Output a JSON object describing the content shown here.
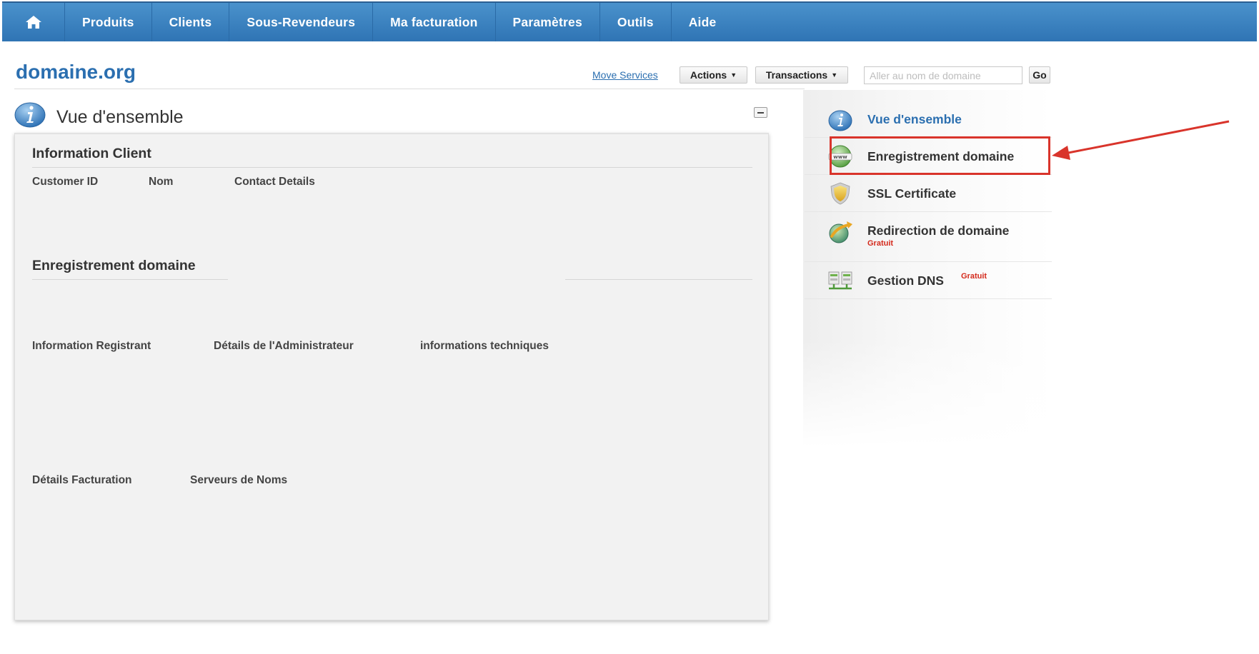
{
  "nav": {
    "home_icon": "home-icon",
    "items": [
      "Produits",
      "Clients",
      "Sous-Revendeurs",
      "Ma facturation",
      "Paramètres",
      "Outils",
      "Aide"
    ]
  },
  "header": {
    "domain": "domaine.org",
    "move_services": "Move Services",
    "actions": "Actions",
    "transactions": "Transactions",
    "search_placeholder": "Aller au nom de domaine",
    "go": "Go"
  },
  "overview": {
    "title": "Vue d'ensemble",
    "icon": "info-icon",
    "client_section": {
      "title": "Information Client",
      "fields": [
        "Customer ID",
        "Nom",
        "Contact Details"
      ]
    },
    "domain_section": {
      "title": "Enregistrement domaine",
      "fields_row1": [
        "Information Registrant",
        "Détails de l'Administrateur",
        "informations techniques"
      ],
      "fields_row2": [
        "Détails Facturation",
        "Serveurs de Noms"
      ]
    }
  },
  "sidebar": {
    "items": [
      {
        "label": "Vue d'ensemble",
        "icon": "info-icon",
        "active": true
      },
      {
        "label": "Enregistrement domaine",
        "icon": "www-globe-icon",
        "highlighted": true
      },
      {
        "label": "SSL Certificate",
        "icon": "shield-icon"
      },
      {
        "label": "Redirection de domaine",
        "icon": "redirect-globe-icon",
        "badge": "Gratuit"
      },
      {
        "label": "Gestion DNS",
        "icon": "dns-servers-icon",
        "badge": "Gratuit"
      }
    ]
  },
  "colors": {
    "nav_bg": "#3a84c2",
    "link_blue": "#2b6fb0",
    "badge_red": "#d42a1c",
    "highlight_red": "#d9342b"
  }
}
